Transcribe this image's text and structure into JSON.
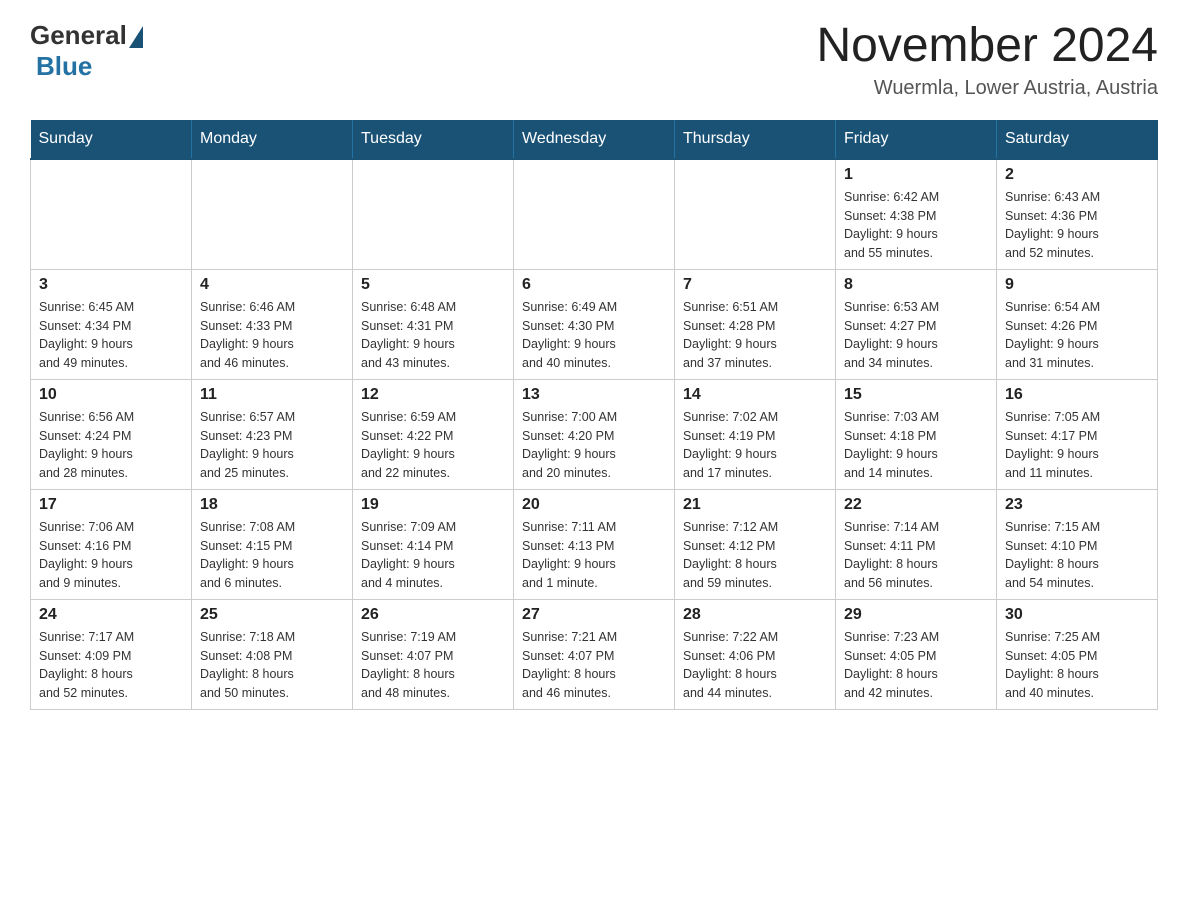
{
  "logo": {
    "general": "General",
    "blue": "Blue"
  },
  "title": "November 2024",
  "subtitle": "Wuermla, Lower Austria, Austria",
  "days_of_week": [
    "Sunday",
    "Monday",
    "Tuesday",
    "Wednesday",
    "Thursday",
    "Friday",
    "Saturday"
  ],
  "weeks": [
    [
      {
        "day": "",
        "info": ""
      },
      {
        "day": "",
        "info": ""
      },
      {
        "day": "",
        "info": ""
      },
      {
        "day": "",
        "info": ""
      },
      {
        "day": "",
        "info": ""
      },
      {
        "day": "1",
        "info": "Sunrise: 6:42 AM\nSunset: 4:38 PM\nDaylight: 9 hours\nand 55 minutes."
      },
      {
        "day": "2",
        "info": "Sunrise: 6:43 AM\nSunset: 4:36 PM\nDaylight: 9 hours\nand 52 minutes."
      }
    ],
    [
      {
        "day": "3",
        "info": "Sunrise: 6:45 AM\nSunset: 4:34 PM\nDaylight: 9 hours\nand 49 minutes."
      },
      {
        "day": "4",
        "info": "Sunrise: 6:46 AM\nSunset: 4:33 PM\nDaylight: 9 hours\nand 46 minutes."
      },
      {
        "day": "5",
        "info": "Sunrise: 6:48 AM\nSunset: 4:31 PM\nDaylight: 9 hours\nand 43 minutes."
      },
      {
        "day": "6",
        "info": "Sunrise: 6:49 AM\nSunset: 4:30 PM\nDaylight: 9 hours\nand 40 minutes."
      },
      {
        "day": "7",
        "info": "Sunrise: 6:51 AM\nSunset: 4:28 PM\nDaylight: 9 hours\nand 37 minutes."
      },
      {
        "day": "8",
        "info": "Sunrise: 6:53 AM\nSunset: 4:27 PM\nDaylight: 9 hours\nand 34 minutes."
      },
      {
        "day": "9",
        "info": "Sunrise: 6:54 AM\nSunset: 4:26 PM\nDaylight: 9 hours\nand 31 minutes."
      }
    ],
    [
      {
        "day": "10",
        "info": "Sunrise: 6:56 AM\nSunset: 4:24 PM\nDaylight: 9 hours\nand 28 minutes."
      },
      {
        "day": "11",
        "info": "Sunrise: 6:57 AM\nSunset: 4:23 PM\nDaylight: 9 hours\nand 25 minutes."
      },
      {
        "day": "12",
        "info": "Sunrise: 6:59 AM\nSunset: 4:22 PM\nDaylight: 9 hours\nand 22 minutes."
      },
      {
        "day": "13",
        "info": "Sunrise: 7:00 AM\nSunset: 4:20 PM\nDaylight: 9 hours\nand 20 minutes."
      },
      {
        "day": "14",
        "info": "Sunrise: 7:02 AM\nSunset: 4:19 PM\nDaylight: 9 hours\nand 17 minutes."
      },
      {
        "day": "15",
        "info": "Sunrise: 7:03 AM\nSunset: 4:18 PM\nDaylight: 9 hours\nand 14 minutes."
      },
      {
        "day": "16",
        "info": "Sunrise: 7:05 AM\nSunset: 4:17 PM\nDaylight: 9 hours\nand 11 minutes."
      }
    ],
    [
      {
        "day": "17",
        "info": "Sunrise: 7:06 AM\nSunset: 4:16 PM\nDaylight: 9 hours\nand 9 minutes."
      },
      {
        "day": "18",
        "info": "Sunrise: 7:08 AM\nSunset: 4:15 PM\nDaylight: 9 hours\nand 6 minutes."
      },
      {
        "day": "19",
        "info": "Sunrise: 7:09 AM\nSunset: 4:14 PM\nDaylight: 9 hours\nand 4 minutes."
      },
      {
        "day": "20",
        "info": "Sunrise: 7:11 AM\nSunset: 4:13 PM\nDaylight: 9 hours\nand 1 minute."
      },
      {
        "day": "21",
        "info": "Sunrise: 7:12 AM\nSunset: 4:12 PM\nDaylight: 8 hours\nand 59 minutes."
      },
      {
        "day": "22",
        "info": "Sunrise: 7:14 AM\nSunset: 4:11 PM\nDaylight: 8 hours\nand 56 minutes."
      },
      {
        "day": "23",
        "info": "Sunrise: 7:15 AM\nSunset: 4:10 PM\nDaylight: 8 hours\nand 54 minutes."
      }
    ],
    [
      {
        "day": "24",
        "info": "Sunrise: 7:17 AM\nSunset: 4:09 PM\nDaylight: 8 hours\nand 52 minutes."
      },
      {
        "day": "25",
        "info": "Sunrise: 7:18 AM\nSunset: 4:08 PM\nDaylight: 8 hours\nand 50 minutes."
      },
      {
        "day": "26",
        "info": "Sunrise: 7:19 AM\nSunset: 4:07 PM\nDaylight: 8 hours\nand 48 minutes."
      },
      {
        "day": "27",
        "info": "Sunrise: 7:21 AM\nSunset: 4:07 PM\nDaylight: 8 hours\nand 46 minutes."
      },
      {
        "day": "28",
        "info": "Sunrise: 7:22 AM\nSunset: 4:06 PM\nDaylight: 8 hours\nand 44 minutes."
      },
      {
        "day": "29",
        "info": "Sunrise: 7:23 AM\nSunset: 4:05 PM\nDaylight: 8 hours\nand 42 minutes."
      },
      {
        "day": "30",
        "info": "Sunrise: 7:25 AM\nSunset: 4:05 PM\nDaylight: 8 hours\nand 40 minutes."
      }
    ]
  ]
}
